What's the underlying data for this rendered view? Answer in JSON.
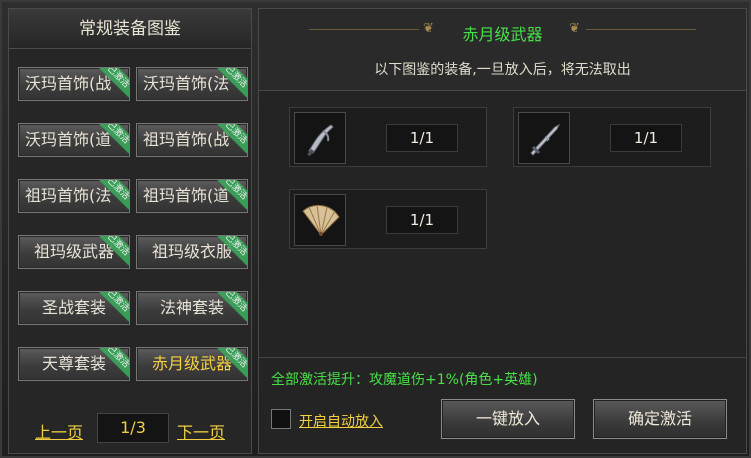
{
  "left_panel": {
    "title": "常规装备图鉴",
    "categories": [
      {
        "label": "沃玛首饰(战",
        "tag": "已激活"
      },
      {
        "label": "沃玛首饰(法",
        "tag": "已激活"
      },
      {
        "label": "沃玛首饰(道",
        "tag": "已激活"
      },
      {
        "label": "祖玛首饰(战",
        "tag": "已激活"
      },
      {
        "label": "祖玛首饰(法",
        "tag": "已激活"
      },
      {
        "label": "祖玛首饰(道",
        "tag": "已激活"
      },
      {
        "label": "祖玛级武器",
        "tag": "已激活"
      },
      {
        "label": "祖玛级衣服",
        "tag": "已激活"
      },
      {
        "label": "圣战套装",
        "tag": "已激活"
      },
      {
        "label": "法神套装",
        "tag": "已激活"
      },
      {
        "label": "天尊套装",
        "tag": "已激活"
      },
      {
        "label": "赤月级武器",
        "tag": "已激活"
      }
    ],
    "pager": {
      "prev": "上一页",
      "page": "1/3",
      "next": "下一页"
    }
  },
  "right_panel": {
    "title": "赤月级武器",
    "subtitle": "以下图鉴的装备,一旦放入后，将无法取出",
    "items": [
      {
        "icon": "blade-weapon-icon",
        "count": "1/1"
      },
      {
        "icon": "sword-weapon-icon",
        "count": "1/1"
      },
      {
        "icon": "fan-weapon-icon",
        "count": "1/1"
      }
    ],
    "bonus": "全部激活提升：攻魔道伤+1%(角色+英雄)",
    "auto_label": "开启自动放入",
    "btn_put_all": "一键放入",
    "btn_confirm": "确定激活"
  },
  "colors": {
    "accent_green": "#48e048",
    "accent_gold": "#f0d040",
    "tag_green": "#3aa55a"
  }
}
